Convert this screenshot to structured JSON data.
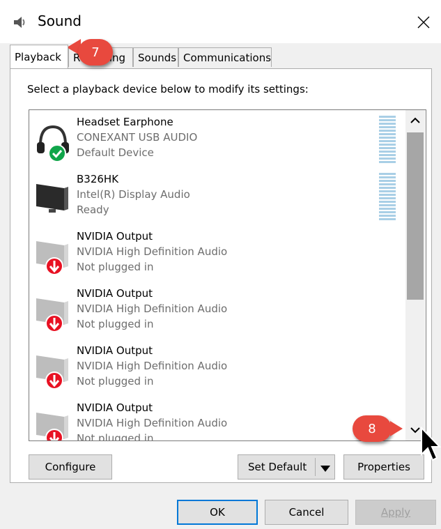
{
  "window": {
    "title": "Sound"
  },
  "tabs": [
    {
      "label": "Playback"
    },
    {
      "label": "Recording"
    },
    {
      "label": "Sounds"
    },
    {
      "label": "Communications"
    }
  ],
  "instruction": "Select a playback device below to modify its settings:",
  "devices": [
    {
      "name": "Headset Earphone",
      "driver": "CONEXANT USB AUDIO",
      "status": "Default Device",
      "icon": "headset-icon"
    },
    {
      "name": "B326HK",
      "driver": "Intel(R) Display Audio",
      "status": "Ready",
      "icon": "monitor-icon"
    },
    {
      "name": "NVIDIA Output",
      "driver": "NVIDIA High Definition Audio",
      "status": "Not plugged in",
      "icon": "monitor-unplugged-icon"
    },
    {
      "name": "NVIDIA Output",
      "driver": "NVIDIA High Definition Audio",
      "status": "Not plugged in",
      "icon": "monitor-unplugged-icon"
    },
    {
      "name": "NVIDIA Output",
      "driver": "NVIDIA High Definition Audio",
      "status": "Not plugged in",
      "icon": "monitor-unplugged-icon"
    },
    {
      "name": "NVIDIA Output",
      "driver": "NVIDIA High Definition Audio",
      "status": "Not plugged in",
      "icon": "monitor-unplugged-icon"
    }
  ],
  "buttons": {
    "configure": "Configure",
    "set_default": "Set Default",
    "properties": "Properties",
    "ok": "OK",
    "cancel": "Cancel",
    "apply": "Apply"
  },
  "callouts": {
    "step7": "7",
    "step8": "8"
  },
  "colors": {
    "accent": "#0078d7",
    "callout": "#e8493e",
    "default_check": "#10a54a",
    "unplugged": "#e81123"
  }
}
